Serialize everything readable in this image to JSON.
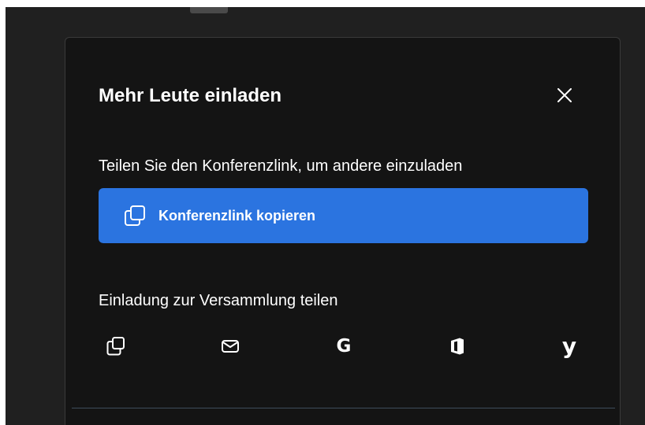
{
  "dialog": {
    "title": "Mehr Leute einladen",
    "close_icon": "close-icon",
    "share_link_text": "Teilen Sie den Konferenzlink, um andere einzuladen",
    "copy_link_button": {
      "label": "Konferenzlink kopieren",
      "icon": "copy-icon",
      "color": "#2b74e0"
    },
    "share_invite_text": "Einladung zur Versammlung teilen",
    "share_options": [
      {
        "icon": "copy-icon"
      },
      {
        "icon": "mail-icon"
      },
      {
        "icon": "google-icon"
      },
      {
        "icon": "office-icon"
      },
      {
        "icon": "yahoo-icon"
      }
    ]
  },
  "colors": {
    "background": "#202020",
    "dialog_background": "#141414",
    "accent": "#2b74e0",
    "text": "#ffffff"
  }
}
